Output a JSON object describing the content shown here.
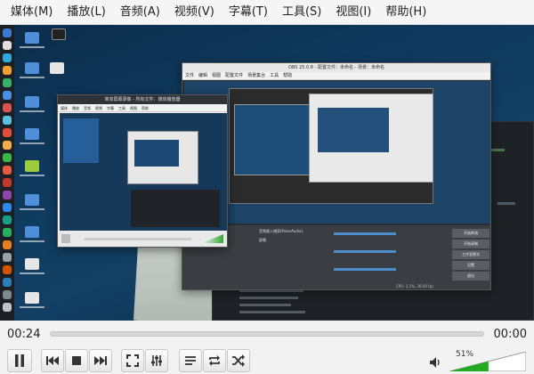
{
  "menu": [
    {
      "label": "媒体(M)"
    },
    {
      "label": "播放(L)"
    },
    {
      "label": "音频(A)"
    },
    {
      "label": "视频(V)"
    },
    {
      "label": "字幕(T)"
    },
    {
      "label": "工具(S)"
    },
    {
      "label": "视图(I)"
    },
    {
      "label": "帮助(H)"
    }
  ],
  "playback": {
    "elapsed": "00:24",
    "remaining": "00:00",
    "position_fraction": 0.0
  },
  "volume": {
    "label": "51%",
    "level": 0.51
  },
  "screenshot": {
    "front_window_title": "简单屏幕录像 - 所有文件：媒体播放器",
    "back_window_title": "OBS 25.0.8 - 配置文件：未命名 - 场景：未命名",
    "back_menu": [
      "文件",
      "编辑",
      "视图",
      "配置文件",
      "场景集合",
      "工具",
      "帮助"
    ],
    "front_menu": [
      "媒体",
      "播放",
      "音频",
      "视频",
      "字幕",
      "工具",
      "视图",
      "帮助"
    ],
    "obs_sources": [
      "音频输入捕获(PulseAudio)",
      "屏幕"
    ],
    "obs_buttons": [
      "开始串流",
      "开始录制",
      "工作室模式",
      "设置",
      "退出"
    ],
    "stats": "CPU: 3.1%, 30.00 fps"
  },
  "colors": {
    "accent_volume": "#22aa22",
    "desktop_bg": "#0f3a5e"
  },
  "icons": {
    "play_pause": "pause-icon",
    "previous": "skip-previous-icon",
    "stop": "stop-icon",
    "next": "skip-next-icon",
    "fullscreen": "fullscreen-icon",
    "extended_settings": "equalizer-icon",
    "playlist": "playlist-icon",
    "loop": "loop-icon",
    "random": "shuffle-icon",
    "volume": "speaker-icon"
  }
}
